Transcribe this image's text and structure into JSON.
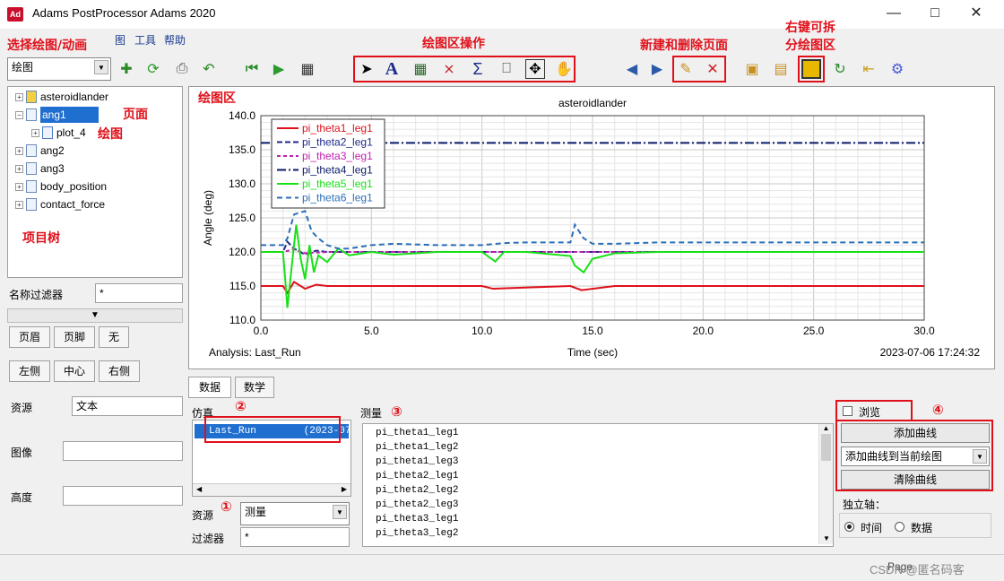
{
  "window": {
    "icon_text": "Ad",
    "title": "Adams PostProcessor Adams 2020"
  },
  "menu": {
    "items": [
      "图",
      "工具",
      "帮助"
    ]
  },
  "annotations": {
    "select_mode": "选择绘图/动画",
    "plot_ops": "绘图区操作",
    "new_delete_page": "新建和删除页面",
    "split_line1": "右键可拆",
    "split_line2": "分绘图区",
    "page": "页面",
    "plot": "绘图",
    "plot_area": "绘图区",
    "project_tree": "项目树",
    "n1": "①",
    "n2": "②",
    "n3": "③",
    "n4": "④"
  },
  "mode_select": {
    "value": "绘图"
  },
  "tree": {
    "items": [
      {
        "label": "asteroidlander"
      },
      {
        "label": "ang1"
      },
      {
        "label": "plot_4"
      },
      {
        "label": "ang2"
      },
      {
        "label": "ang3"
      },
      {
        "label": "body_position"
      },
      {
        "label": "contact_force"
      }
    ]
  },
  "left_panel": {
    "name_filter_label": "名称过滤器",
    "name_filter_value": "*",
    "tabs_row1": [
      "页眉",
      "页脚",
      "无"
    ],
    "tabs_row2": [
      "左侧",
      "中心",
      "右侧"
    ],
    "source_label": "资源",
    "source_value": "文本",
    "image_label": "图像",
    "height_label": "高度"
  },
  "chart_data": {
    "type": "line",
    "title": "asteroidlander",
    "xlabel": "Time (sec)",
    "ylabel": "Angle (deg)",
    "xlim": [
      0,
      30
    ],
    "ylim": [
      110,
      140
    ],
    "xticks": [
      "0.0",
      "5.0",
      "10.0",
      "15.0",
      "20.0",
      "25.0",
      "30.0"
    ],
    "yticks": [
      "110.0",
      "115.0",
      "120.0",
      "125.0",
      "130.0",
      "135.0",
      "140.0"
    ],
    "legend_position": "top-left",
    "grid": true,
    "analysis_label": "Analysis:  Last_Run",
    "timestamp": "2023-07-06 17:24:32",
    "series": [
      {
        "name": "pi_theta1_leg1",
        "color": "#e0101a",
        "dash": "solid",
        "x": [
          0,
          1,
          1.2,
          1.5,
          2,
          2.5,
          3,
          4,
          5,
          8,
          10,
          10.5,
          14,
          14.5,
          16,
          20,
          25,
          30
        ],
        "y": [
          115,
          115,
          114,
          115.6,
          114.6,
          115.2,
          115,
          115,
          115,
          115,
          115,
          114.6,
          115,
          114.4,
          115,
          115,
          115,
          115
        ]
      },
      {
        "name": "pi_theta2_leg1",
        "color": "#1f2a8c",
        "dash": "6,3",
        "x": [
          0,
          1,
          1.2,
          1.5,
          2,
          2.5,
          3,
          4,
          5,
          10,
          15,
          20,
          25,
          30
        ],
        "y": [
          120,
          120,
          121.5,
          120.5,
          119.6,
          120.2,
          120,
          120,
          120,
          120,
          120,
          120,
          120,
          120
        ]
      },
      {
        "name": "pi_theta3_leg1",
        "color": "#c020b0",
        "dash": "4,3",
        "x": [
          0,
          1,
          1.5,
          2,
          3,
          4,
          5,
          10,
          15,
          20,
          25,
          30
        ],
        "y": [
          120,
          120,
          120.4,
          119.8,
          120,
          120,
          120,
          120,
          120,
          120,
          120,
          120
        ]
      },
      {
        "name": "pi_theta4_leg1",
        "color": "#0a1a6a",
        "dash": "10,3,2,3",
        "x": [
          0,
          30
        ],
        "y": [
          136,
          136
        ]
      },
      {
        "name": "pi_theta5_leg1",
        "color": "#18e018",
        "dash": "solid",
        "x": [
          0,
          1,
          1.1,
          1.2,
          1.4,
          1.6,
          1.8,
          2.0,
          2.2,
          2.4,
          2.6,
          3,
          3.5,
          4,
          5,
          6,
          8,
          10,
          10.6,
          11,
          12,
          14,
          14.2,
          14.6,
          15,
          16,
          18,
          20,
          25,
          30
        ],
        "y": [
          120,
          120,
          116,
          111.8,
          118,
          124,
          119,
          116,
          121,
          117,
          119.5,
          118.5,
          120.5,
          119.5,
          120,
          119.6,
          120,
          120,
          118.6,
          120,
          120,
          119.4,
          118,
          117,
          119,
          119.8,
          120,
          120,
          120,
          120
        ]
      },
      {
        "name": "pi_theta6_leg1",
        "color": "#2a6fb8",
        "dash": "6,4",
        "x": [
          0,
          1,
          1.2,
          1.5,
          2,
          2.3,
          2.6,
          3,
          3.5,
          4,
          5,
          6,
          8,
          10,
          11,
          12,
          14,
          14.2,
          14.6,
          15,
          16,
          18,
          20,
          25,
          30
        ],
        "y": [
          121,
          121,
          122,
          125.5,
          126,
          123,
          122,
          121,
          120.5,
          120.5,
          121,
          121.2,
          121,
          121,
          121.3,
          121.4,
          121.4,
          124,
          122,
          121.2,
          121.2,
          121.4,
          121.4,
          121.4,
          121.4
        ]
      }
    ]
  },
  "bottom": {
    "tabs": [
      "数据",
      "数学"
    ],
    "sim_label": "仿真",
    "sim_row": "Last_Run        (2023-07",
    "measure_label": "测量",
    "measures": [
      "pi_theta1_leg1",
      "pi_theta1_leg2",
      "pi_theta1_leg3",
      "pi_theta2_leg1",
      "pi_theta2_leg2",
      "pi_theta2_leg3",
      "pi_theta3_leg1",
      "pi_theta3_leg2"
    ],
    "source_label": "资源",
    "source_value": "测量",
    "filter_label": "过滤器",
    "filter_value": "*",
    "browse_label": "浏览",
    "add_curve": "添加曲线",
    "add_to_current": "添加曲线到当前绘图",
    "clear_curve": "清除曲线",
    "indep_axis": "独立轴：",
    "radio_time": "时间",
    "radio_data": "数据"
  },
  "status": {
    "page": "Page",
    "watermark": "CSDN @匿名码客"
  }
}
